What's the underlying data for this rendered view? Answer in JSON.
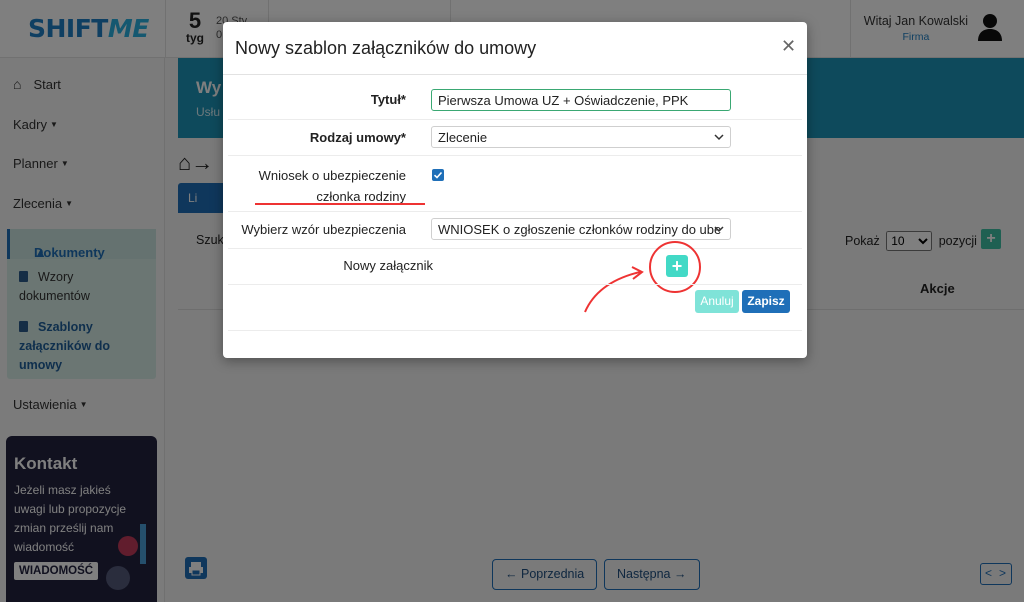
{
  "app": {
    "logo_part1": "SHIFT",
    "logo_part2": "ME"
  },
  "header": {
    "week_number": "5",
    "week_label": "tyg",
    "week_date_line1": "20 Sty",
    "week_date_line2": "0",
    "greeting": "Witaj Jan Kowalski",
    "company": "Firma"
  },
  "sidebar": {
    "items": [
      {
        "label": "Start"
      },
      {
        "label": "Kadry"
      },
      {
        "label": "Planner"
      },
      {
        "label": "Zlecenia"
      },
      {
        "label": "Dokumenty"
      },
      {
        "label": "Ustawienia"
      }
    ],
    "sub_items": [
      {
        "label": "Wzory dokumentów"
      },
      {
        "label": "Szablony załączników do umowy"
      }
    ],
    "contact": {
      "title": "Kontakt",
      "text": "Jeżeli masz jakieś uwagi lub propozycje zmian prześlij nam wiadomość",
      "button": "WIADOMOŚĆ"
    }
  },
  "main": {
    "banner_title": "Wy",
    "banner_subtitle": "Usłu",
    "tab_label": "Li",
    "search_label": "Szuk",
    "show_label": "Pokaż",
    "show_value": "10",
    "positions_label": "pozycji",
    "col_actions": "Akcje",
    "prev_button": "Poprzednia",
    "next_button": "Następna"
  },
  "modal": {
    "title": "Nowy szablon załączników do umowy",
    "fields": {
      "title_label": "Tytuł*",
      "title_value": "Pierwsza Umowa UZ + Oświadczenie, PPK",
      "contract_type_label": "Rodzaj umowy*",
      "contract_type_value": "Zlecenie",
      "insurance_request_label_line1": "Wniosek o ubezpieczenie",
      "insurance_request_label_line2": "członka rodziny",
      "insurance_request_checked": true,
      "insurance_template_label": "Wybierz wzór ubezpieczenia",
      "insurance_template_value": "WNIOSEK o zgłoszenie członków rodziny do ube",
      "new_attachment_label": "Nowy załącznik"
    },
    "buttons": {
      "cancel": "Anuluj",
      "save": "Zapisz"
    }
  },
  "colors": {
    "primary": "#1f6fb8",
    "teal": "#42d9c6",
    "annotation": "#e33333"
  }
}
